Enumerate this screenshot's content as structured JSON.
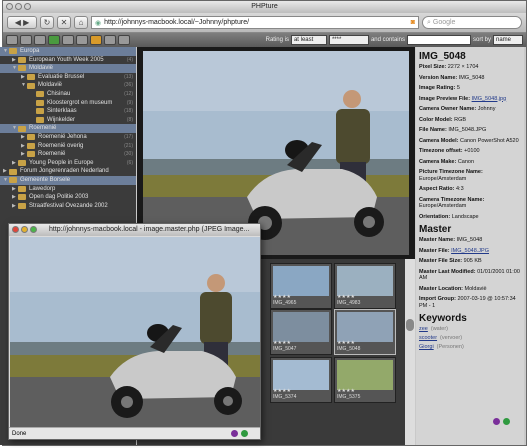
{
  "main_window": {
    "title": "PHPture",
    "url": "http://johnnys-macbook.local/~Johnny/phpture/",
    "search_placeholder": "Google"
  },
  "appbar": {
    "rating_label": "Rating is",
    "rating_mode": "at least",
    "rating_value": "****",
    "contains_label": "and contains",
    "sort_label": "sort by",
    "sort_value": "name"
  },
  "sidebar": {
    "items": [
      {
        "label": "Europa",
        "count": "",
        "indent": 0,
        "tri": "▼",
        "selected": true
      },
      {
        "label": "European Youth Week 2005",
        "count": "(4)",
        "indent": 1,
        "tri": "▶",
        "selected": false
      },
      {
        "label": "Moldavië",
        "count": "",
        "indent": 1,
        "tri": "▼",
        "selected": true
      },
      {
        "label": "Evaluatie Brussel",
        "count": "(13)",
        "indent": 2,
        "tri": "▶",
        "selected": false
      },
      {
        "label": "Moldavië",
        "count": "(36)",
        "indent": 2,
        "tri": "▼",
        "selected": false
      },
      {
        "label": "Chisinau",
        "count": "(12)",
        "indent": 3,
        "tri": "",
        "selected": false
      },
      {
        "label": "Kloostergrot en museum",
        "count": "(9)",
        "indent": 3,
        "tri": "",
        "selected": false
      },
      {
        "label": "Sinterklaas",
        "count": "(18)",
        "indent": 3,
        "tri": "",
        "selected": false
      },
      {
        "label": "Wijnkelder",
        "count": "(8)",
        "indent": 3,
        "tri": "",
        "selected": false
      },
      {
        "label": "Roemenië",
        "count": "",
        "indent": 1,
        "tri": "▼",
        "selected": true
      },
      {
        "label": "Roemenië Jehona",
        "count": "(17)",
        "indent": 2,
        "tri": "▶",
        "selected": false
      },
      {
        "label": "Roemenië overig",
        "count": "(21)",
        "indent": 2,
        "tri": "▶",
        "selected": false
      },
      {
        "label": "Roemenië",
        "count": "(30)",
        "indent": 2,
        "tri": "▶",
        "selected": false
      },
      {
        "label": "Young People in Europe",
        "count": "(6)",
        "indent": 1,
        "tri": "▶",
        "selected": false
      },
      {
        "label": "Forum Jongerenraden Nederland",
        "count": "",
        "indent": 0,
        "tri": "▶",
        "selected": false
      },
      {
        "label": "Gemeente Borsele",
        "count": "",
        "indent": 0,
        "tri": "▼",
        "selected": true
      },
      {
        "label": "Lawedorp",
        "count": "",
        "indent": 1,
        "tri": "▶",
        "selected": false
      },
      {
        "label": "Open dag Politie 2003",
        "count": "",
        "indent": 1,
        "tri": "▶",
        "selected": false
      },
      {
        "label": "Straatfestival Ovezande 2002",
        "count": "",
        "indent": 1,
        "tri": "▶",
        "selected": false
      }
    ]
  },
  "thumbnails": [
    {
      "caption": "IMG_4965",
      "stars": "★★★★"
    },
    {
      "caption": "IMG_4983",
      "stars": "★★★★"
    },
    {
      "caption": "IMG_5047",
      "stars": "★★★★"
    },
    {
      "caption": "IMG_5048",
      "stars": "★★★★"
    },
    {
      "caption": "IMG_5374",
      "stars": "★★★★"
    },
    {
      "caption": "IMG_5375",
      "stars": "★★★★"
    }
  ],
  "info": {
    "title": "IMG_5048",
    "rows": [
      {
        "label": "Pixel Size:",
        "value": "2272 × 1704"
      },
      {
        "label": "Version Name:",
        "value": "IMG_5048"
      },
      {
        "label": "Image Rating:",
        "value": "5"
      },
      {
        "label": "Image Preview File:",
        "value": "IMG_5048.jpg",
        "link": true
      },
      {
        "label": "Camera Owner Name:",
        "value": "Johnny"
      },
      {
        "label": "Color Model:",
        "value": "RGB"
      },
      {
        "label": "File Name:",
        "value": "IMG_5048.JPG"
      },
      {
        "label": "Camera Model:",
        "value": "Canon PowerShot A520"
      },
      {
        "label": "Timezone offset:",
        "value": "+0100"
      },
      {
        "label": "Camera Make:",
        "value": "Canon"
      },
      {
        "label": "Picture Timezone Name:",
        "value": "Europe/Amsterdam"
      },
      {
        "label": "Aspect Ratio:",
        "value": "4:3"
      },
      {
        "label": "Camera Timezone Name:",
        "value": "Europe/Amsterdam"
      },
      {
        "label": "Orientation:",
        "value": "Landscape"
      }
    ],
    "master_title": "Master",
    "master_rows": [
      {
        "label": "Master Name:",
        "value": "IMG_5048"
      },
      {
        "label": "Master File:",
        "value": "IMG_5048.JPG",
        "link": true
      },
      {
        "label": "Master File Size:",
        "value": "905 KB"
      },
      {
        "label": "Master Last Modified:",
        "value": "01/01/2001 01:00 AM"
      },
      {
        "label": "Master Location:",
        "value": "Moldavië"
      },
      {
        "label": "Import Group:",
        "value": "2007-03-19 @ 10:57:34 PM - 1"
      }
    ],
    "keywords_title": "Keywords",
    "keywords": [
      {
        "word": "zee",
        "note": "(water)"
      },
      {
        "word": "scooter",
        "note": "(vervoer)"
      },
      {
        "word": "Giorgi",
        "note": "(Personen)"
      }
    ]
  },
  "popup": {
    "title": "http://johnnys-macbook.local - image.master.php (JPEG Image...",
    "status": "Done"
  },
  "colors": {
    "sky": "#9fb4cc",
    "sea": "#6d7c82",
    "grass": "#7d7a3a",
    "road": "#5e5e5e",
    "scooter": "#c9c9c9"
  }
}
